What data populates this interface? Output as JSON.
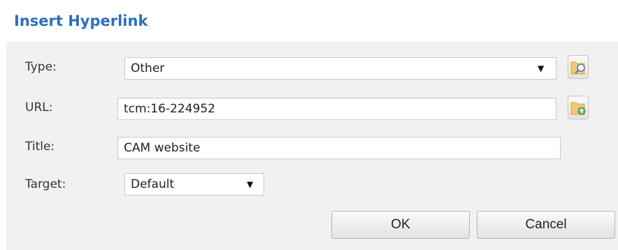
{
  "dialog": {
    "title": "Insert Hyperlink"
  },
  "form": {
    "type": {
      "label": "Type:",
      "value": "Other"
    },
    "url": {
      "label": "URL:",
      "value": "tcm:16-224952"
    },
    "title": {
      "label": "Title:",
      "value": "CAM website"
    },
    "target": {
      "label": "Target:",
      "value": "Default"
    }
  },
  "icons": {
    "browse": "folder-search-icon",
    "upload": "folder-upload-icon",
    "dropdown": "dropdown-arrow-icon"
  },
  "buttons": {
    "ok_label": "OK",
    "cancel_label": "Cancel"
  },
  "colors": {
    "title": "#2f6eb7",
    "panel_background": "#f1f1f1",
    "folder_icon": "#f2c879"
  }
}
